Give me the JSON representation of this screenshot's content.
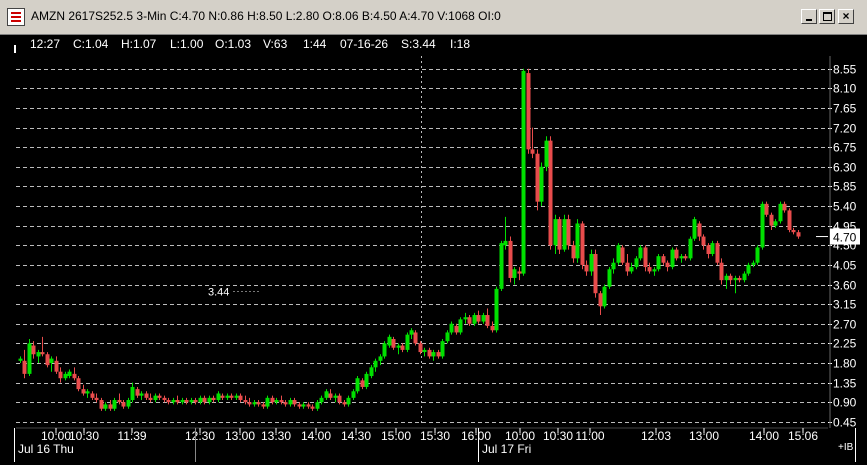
{
  "window": {
    "title": "AMZN 2617S252.5 3-Min C:4.70 N:0.86 H:8.50 L:2.80 O:8.06 B:4.50 A:4.70 V:1068 OI:0"
  },
  "infobar": {
    "time": "12:27",
    "close": "C:1.04",
    "high": "H:1.07",
    "low": "L:1.00",
    "open": "O:1.03",
    "volume": "V:63",
    "duration": "1:44",
    "date": "07-16-26",
    "strike": "S:3.44",
    "interval": "I:18"
  },
  "corner_label": "+IB",
  "chart_data": {
    "type": "candlestick",
    "title": "AMZN 2617S252.5 3-Min",
    "y_ticks": [
      "8.55",
      "8.10",
      "7.65",
      "7.20",
      "6.75",
      "6.30",
      "5.85",
      "5.40",
      "4.95",
      "4.50",
      "4.05",
      "3.60",
      "3.15",
      "2.70",
      "2.25",
      "1.80",
      "1.35",
      "0.90",
      "0.45"
    ],
    "ylim": [
      0.4,
      8.75
    ],
    "last_price": "4.70",
    "annotation": {
      "text": "3.44",
      "x": 12,
      "y": 3.44
    },
    "x_time_labels": [
      "10:00",
      "10:30",
      "11:39",
      "12:30",
      "13:00",
      "13:30",
      "14:00",
      "14:30",
      "15:00",
      "15:30",
      "16:00",
      "10:00",
      "10:30",
      "11:00",
      "12:03",
      "13:00",
      "14:00",
      "15:06"
    ],
    "x_time_index": [
      10,
      23,
      32,
      45,
      54,
      63,
      73,
      83,
      93,
      103,
      114,
      125,
      135,
      144,
      158,
      170,
      183,
      192
    ],
    "x_date_labels": [
      "Jul 16 Thu",
      "Jul 17 Fri"
    ],
    "x_date_index": [
      0,
      116
    ],
    "session_break_index": 116,
    "x_count": 203,
    "candles": [
      {
        "o": 1.85,
        "h": 1.95,
        "l": 1.8,
        "c": 1.9
      },
      {
        "o": 1.85,
        "h": 2.1,
        "l": 1.45,
        "c": 1.55
      },
      {
        "o": 1.55,
        "h": 2.35,
        "l": 1.5,
        "c": 2.25
      },
      {
        "o": 2.2,
        "h": 2.3,
        "l": 1.9,
        "c": 2.0
      },
      {
        "o": 1.95,
        "h": 2.1,
        "l": 1.8,
        "c": 2.05
      },
      {
        "o": 2.05,
        "h": 2.4,
        "l": 1.95,
        "c": 2.0
      },
      {
        "o": 2.0,
        "h": 2.05,
        "l": 1.7,
        "c": 1.75
      },
      {
        "o": 1.8,
        "h": 1.95,
        "l": 1.6,
        "c": 1.9
      },
      {
        "o": 1.85,
        "h": 1.95,
        "l": 1.55,
        "c": 1.6
      },
      {
        "o": 1.6,
        "h": 1.7,
        "l": 1.35,
        "c": 1.45
      },
      {
        "o": 1.45,
        "h": 1.6,
        "l": 1.4,
        "c": 1.55
      },
      {
        "o": 1.5,
        "h": 1.65,
        "l": 1.45,
        "c": 1.6
      },
      {
        "o": 1.55,
        "h": 1.7,
        "l": 1.4,
        "c": 1.45
      },
      {
        "o": 1.45,
        "h": 1.5,
        "l": 1.15,
        "c": 1.2
      },
      {
        "o": 1.2,
        "h": 1.3,
        "l": 1.05,
        "c": 1.1
      },
      {
        "o": 1.1,
        "h": 1.2,
        "l": 1.0,
        "c": 1.15
      },
      {
        "o": 1.1,
        "h": 1.15,
        "l": 0.95,
        "c": 1.0
      },
      {
        "o": 1.0,
        "h": 1.1,
        "l": 0.9,
        "c": 0.95
      },
      {
        "o": 0.95,
        "h": 1.0,
        "l": 0.7,
        "c": 0.75
      },
      {
        "o": 0.75,
        "h": 0.9,
        "l": 0.7,
        "c": 0.85
      },
      {
        "o": 0.85,
        "h": 0.95,
        "l": 0.7,
        "c": 0.75
      },
      {
        "o": 0.75,
        "h": 1.0,
        "l": 0.7,
        "c": 0.95
      },
      {
        "o": 0.95,
        "h": 1.1,
        "l": 0.85,
        "c": 0.9
      },
      {
        "o": 0.9,
        "h": 0.95,
        "l": 0.75,
        "c": 0.8
      },
      {
        "o": 0.8,
        "h": 1.0,
        "l": 0.75,
        "c": 0.95
      },
      {
        "o": 0.95,
        "h": 1.35,
        "l": 0.9,
        "c": 1.25
      },
      {
        "o": 1.2,
        "h": 1.25,
        "l": 1.0,
        "c": 1.05
      },
      {
        "o": 1.05,
        "h": 1.15,
        "l": 0.95,
        "c": 1.1
      },
      {
        "o": 1.1,
        "h": 1.15,
        "l": 0.95,
        "c": 1.0
      },
      {
        "o": 1.0,
        "h": 1.1,
        "l": 0.9,
        "c": 0.95
      },
      {
        "o": 0.95,
        "h": 1.1,
        "l": 0.9,
        "c": 1.05
      },
      {
        "o": 1.05,
        "h": 1.1,
        "l": 0.95,
        "c": 1.0
      },
      {
        "o": 1.0,
        "h": 1.05,
        "l": 0.9,
        "c": 0.95
      },
      {
        "o": 0.95,
        "h": 1.0,
        "l": 0.85,
        "c": 0.9
      },
      {
        "o": 0.9,
        "h": 1.0,
        "l": 0.85,
        "c": 0.95
      },
      {
        "o": 0.95,
        "h": 1.05,
        "l": 0.85,
        "c": 0.9
      },
      {
        "o": 0.9,
        "h": 1.0,
        "l": 0.85,
        "c": 0.95
      },
      {
        "o": 0.95,
        "h": 1.0,
        "l": 0.85,
        "c": 0.9
      },
      {
        "o": 0.9,
        "h": 1.0,
        "l": 0.85,
        "c": 0.95
      },
      {
        "o": 0.95,
        "h": 1.0,
        "l": 0.85,
        "c": 0.9
      },
      {
        "o": 0.9,
        "h": 1.05,
        "l": 0.85,
        "c": 1.0
      },
      {
        "o": 1.0,
        "h": 1.05,
        "l": 0.85,
        "c": 0.9
      },
      {
        "o": 0.9,
        "h": 1.05,
        "l": 0.85,
        "c": 1.0
      },
      {
        "o": 1.0,
        "h": 1.05,
        "l": 0.9,
        "c": 0.95
      },
      {
        "o": 0.95,
        "h": 1.15,
        "l": 0.9,
        "c": 1.1
      },
      {
        "o": 1.05,
        "h": 1.1,
        "l": 0.95,
        "c": 1.0
      },
      {
        "o": 1.0,
        "h": 1.1,
        "l": 0.95,
        "c": 1.05
      },
      {
        "o": 1.05,
        "h": 1.1,
        "l": 0.95,
        "c": 1.0
      },
      {
        "o": 1.0,
        "h": 1.1,
        "l": 0.95,
        "c": 1.05
      },
      {
        "o": 1.05,
        "h": 1.1,
        "l": 0.9,
        "c": 0.95
      },
      {
        "o": 0.95,
        "h": 1.05,
        "l": 0.85,
        "c": 0.9
      },
      {
        "o": 0.9,
        "h": 1.0,
        "l": 0.8,
        "c": 0.85
      },
      {
        "o": 0.85,
        "h": 0.95,
        "l": 0.8,
        "c": 0.9
      },
      {
        "o": 0.9,
        "h": 0.95,
        "l": 0.8,
        "c": 0.85
      },
      {
        "o": 0.85,
        "h": 0.9,
        "l": 0.75,
        "c": 0.8
      },
      {
        "o": 0.8,
        "h": 1.05,
        "l": 0.75,
        "c": 1.0
      },
      {
        "o": 1.0,
        "h": 1.05,
        "l": 0.85,
        "c": 0.9
      },
      {
        "o": 0.9,
        "h": 1.0,
        "l": 0.85,
        "c": 0.95
      },
      {
        "o": 0.95,
        "h": 1.05,
        "l": 0.85,
        "c": 0.9
      },
      {
        "o": 0.9,
        "h": 0.95,
        "l": 0.8,
        "c": 0.85
      },
      {
        "o": 0.85,
        "h": 1.0,
        "l": 0.8,
        "c": 0.95
      },
      {
        "o": 0.95,
        "h": 1.0,
        "l": 0.8,
        "c": 0.85
      },
      {
        "o": 0.85,
        "h": 0.9,
        "l": 0.75,
        "c": 0.8
      },
      {
        "o": 0.8,
        "h": 0.9,
        "l": 0.75,
        "c": 0.85
      },
      {
        "o": 0.85,
        "h": 0.9,
        "l": 0.75,
        "c": 0.8
      },
      {
        "o": 0.8,
        "h": 0.85,
        "l": 0.7,
        "c": 0.75
      },
      {
        "o": 0.75,
        "h": 0.95,
        "l": 0.7,
        "c": 0.9
      },
      {
        "o": 0.9,
        "h": 1.05,
        "l": 0.85,
        "c": 1.0
      },
      {
        "o": 1.0,
        "h": 1.2,
        "l": 0.95,
        "c": 1.15
      },
      {
        "o": 1.1,
        "h": 1.2,
        "l": 0.95,
        "c": 1.0
      },
      {
        "o": 1.0,
        "h": 1.1,
        "l": 0.9,
        "c": 1.05
      },
      {
        "o": 1.05,
        "h": 1.1,
        "l": 0.85,
        "c": 0.9
      },
      {
        "o": 0.9,
        "h": 0.95,
        "l": 0.8,
        "c": 0.85
      },
      {
        "o": 0.85,
        "h": 1.05,
        "l": 0.8,
        "c": 1.0
      },
      {
        "o": 1.0,
        "h": 1.2,
        "l": 0.95,
        "c": 1.15
      },
      {
        "o": 1.15,
        "h": 1.5,
        "l": 1.1,
        "c": 1.45
      },
      {
        "o": 1.4,
        "h": 1.45,
        "l": 1.2,
        "c": 1.25
      },
      {
        "o": 1.25,
        "h": 1.6,
        "l": 1.2,
        "c": 1.55
      },
      {
        "o": 1.5,
        "h": 1.75,
        "l": 1.45,
        "c": 1.7
      },
      {
        "o": 1.7,
        "h": 1.9,
        "l": 1.6,
        "c": 1.85
      },
      {
        "o": 1.85,
        "h": 2.0,
        "l": 1.75,
        "c": 1.95
      },
      {
        "o": 1.95,
        "h": 2.3,
        "l": 1.9,
        "c": 2.25
      },
      {
        "o": 2.2,
        "h": 2.45,
        "l": 2.15,
        "c": 2.4
      },
      {
        "o": 2.35,
        "h": 2.4,
        "l": 2.1,
        "c": 2.15
      },
      {
        "o": 2.15,
        "h": 2.25,
        "l": 2.0,
        "c": 2.2
      },
      {
        "o": 2.2,
        "h": 2.25,
        "l": 2.05,
        "c": 2.1
      },
      {
        "o": 2.1,
        "h": 2.5,
        "l": 2.05,
        "c": 2.45
      },
      {
        "o": 2.45,
        "h": 2.6,
        "l": 2.35,
        "c": 2.55
      },
      {
        "o": 2.5,
        "h": 2.55,
        "l": 2.2,
        "c": 2.25
      },
      {
        "o": 2.25,
        "h": 2.3,
        "l": 2.0,
        "c": 2.05
      },
      {
        "o": 2.05,
        "h": 2.15,
        "l": 1.95,
        "c": 2.1
      },
      {
        "o": 2.1,
        "h": 2.15,
        "l": 1.9,
        "c": 1.95
      },
      {
        "o": 1.95,
        "h": 2.1,
        "l": 1.85,
        "c": 2.05
      },
      {
        "o": 2.05,
        "h": 2.1,
        "l": 1.9,
        "c": 1.95
      },
      {
        "o": 1.95,
        "h": 2.35,
        "l": 1.9,
        "c": 2.3
      },
      {
        "o": 2.3,
        "h": 2.55,
        "l": 2.25,
        "c": 2.5
      },
      {
        "o": 2.5,
        "h": 2.75,
        "l": 2.45,
        "c": 2.7
      },
      {
        "o": 2.65,
        "h": 2.7,
        "l": 2.45,
        "c": 2.5
      },
      {
        "o": 2.5,
        "h": 2.85,
        "l": 2.45,
        "c": 2.8
      },
      {
        "o": 2.8,
        "h": 2.95,
        "l": 2.7,
        "c": 2.85
      },
      {
        "o": 2.85,
        "h": 2.9,
        "l": 2.65,
        "c": 2.7
      },
      {
        "o": 2.7,
        "h": 2.95,
        "l": 2.65,
        "c": 2.9
      },
      {
        "o": 2.9,
        "h": 3.0,
        "l": 2.7,
        "c": 2.75
      },
      {
        "o": 2.75,
        "h": 2.95,
        "l": 2.7,
        "c": 2.9
      },
      {
        "o": 2.9,
        "h": 3.05,
        "l": 2.6,
        "c": 2.65
      },
      {
        "o": 2.65,
        "h": 2.75,
        "l": 2.5,
        "c": 2.55
      },
      {
        "o": 2.55,
        "h": 3.55,
        "l": 2.5,
        "c": 3.5
      },
      {
        "o": 3.5,
        "h": 4.6,
        "l": 3.45,
        "c": 4.55
      },
      {
        "o": 4.5,
        "h": 5.15,
        "l": 4.4,
        "c": 4.6
      },
      {
        "o": 4.6,
        "h": 4.7,
        "l": 3.65,
        "c": 3.75
      },
      {
        "o": 3.75,
        "h": 4.0,
        "l": 3.6,
        "c": 3.95
      },
      {
        "o": 3.9,
        "h": 4.0,
        "l": 3.7,
        "c": 3.85
      },
      {
        "o": 3.85,
        "h": 8.55,
        "l": 3.8,
        "c": 8.5
      },
      {
        "o": 8.45,
        "h": 8.55,
        "l": 6.6,
        "c": 6.7
      },
      {
        "o": 6.7,
        "h": 7.2,
        "l": 6.5,
        "c": 6.6
      },
      {
        "o": 6.6,
        "h": 6.7,
        "l": 5.3,
        "c": 5.5
      },
      {
        "o": 5.5,
        "h": 6.4,
        "l": 5.4,
        "c": 6.3
      },
      {
        "o": 6.3,
        "h": 7.0,
        "l": 6.2,
        "c": 6.9
      },
      {
        "o": 6.9,
        "h": 7.0,
        "l": 4.4,
        "c": 4.5
      },
      {
        "o": 4.5,
        "h": 5.2,
        "l": 4.3,
        "c": 5.1
      },
      {
        "o": 5.1,
        "h": 5.15,
        "l": 4.3,
        "c": 4.4
      },
      {
        "o": 4.4,
        "h": 5.2,
        "l": 4.35,
        "c": 5.1
      },
      {
        "o": 5.1,
        "h": 5.2,
        "l": 4.4,
        "c": 4.5
      },
      {
        "o": 4.5,
        "h": 4.6,
        "l": 4.1,
        "c": 4.2
      },
      {
        "o": 4.2,
        "h": 5.1,
        "l": 4.1,
        "c": 5.0
      },
      {
        "o": 5.0,
        "h": 5.05,
        "l": 3.95,
        "c": 4.05
      },
      {
        "o": 4.05,
        "h": 4.15,
        "l": 3.8,
        "c": 3.9
      },
      {
        "o": 3.9,
        "h": 4.4,
        "l": 3.8,
        "c": 4.3
      },
      {
        "o": 4.3,
        "h": 4.4,
        "l": 3.3,
        "c": 3.4
      },
      {
        "o": 3.4,
        "h": 3.45,
        "l": 2.9,
        "c": 3.1
      },
      {
        "o": 3.1,
        "h": 3.6,
        "l": 3.05,
        "c": 3.55
      },
      {
        "o": 3.55,
        "h": 4.0,
        "l": 3.5,
        "c": 3.95
      },
      {
        "o": 3.95,
        "h": 4.2,
        "l": 3.85,
        "c": 4.1
      },
      {
        "o": 4.1,
        "h": 4.55,
        "l": 4.05,
        "c": 4.5
      },
      {
        "o": 4.45,
        "h": 4.5,
        "l": 4.05,
        "c": 4.1
      },
      {
        "o": 4.1,
        "h": 4.3,
        "l": 3.8,
        "c": 3.9
      },
      {
        "o": 3.9,
        "h": 4.1,
        "l": 3.85,
        "c": 4.0
      },
      {
        "o": 4.0,
        "h": 4.25,
        "l": 3.95,
        "c": 4.2
      },
      {
        "o": 4.2,
        "h": 4.5,
        "l": 4.15,
        "c": 4.45
      },
      {
        "o": 4.45,
        "h": 4.5,
        "l": 3.9,
        "c": 4.0
      },
      {
        "o": 4.0,
        "h": 4.1,
        "l": 3.85,
        "c": 3.9
      },
      {
        "o": 3.9,
        "h": 4.0,
        "l": 3.8,
        "c": 3.95
      },
      {
        "o": 3.95,
        "h": 4.3,
        "l": 3.9,
        "c": 4.25
      },
      {
        "o": 4.25,
        "h": 4.3,
        "l": 4.05,
        "c": 4.1
      },
      {
        "o": 4.1,
        "h": 4.15,
        "l": 3.9,
        "c": 4.0
      },
      {
        "o": 4.0,
        "h": 4.45,
        "l": 3.95,
        "c": 4.4
      },
      {
        "o": 4.4,
        "h": 4.45,
        "l": 4.15,
        "c": 4.2
      },
      {
        "o": 4.2,
        "h": 4.3,
        "l": 4.1,
        "c": 4.25
      },
      {
        "o": 4.25,
        "h": 4.3,
        "l": 4.15,
        "c": 4.2
      },
      {
        "o": 4.2,
        "h": 4.7,
        "l": 4.15,
        "c": 4.65
      },
      {
        "o": 4.65,
        "h": 5.15,
        "l": 4.6,
        "c": 5.1
      },
      {
        "o": 5.0,
        "h": 5.05,
        "l": 4.6,
        "c": 4.7
      },
      {
        "o": 4.7,
        "h": 4.75,
        "l": 4.4,
        "c": 4.5
      },
      {
        "o": 4.5,
        "h": 4.55,
        "l": 4.2,
        "c": 4.3
      },
      {
        "o": 4.3,
        "h": 4.6,
        "l": 4.25,
        "c": 4.55
      },
      {
        "o": 4.55,
        "h": 4.6,
        "l": 4.05,
        "c": 4.1
      },
      {
        "o": 4.1,
        "h": 4.2,
        "l": 3.6,
        "c": 3.7
      },
      {
        "o": 3.7,
        "h": 3.85,
        "l": 3.5,
        "c": 3.8
      },
      {
        "o": 3.8,
        "h": 3.85,
        "l": 3.6,
        "c": 3.7
      },
      {
        "o": 3.7,
        "h": 3.8,
        "l": 3.4,
        "c": 3.75
      },
      {
        "o": 3.75,
        "h": 3.8,
        "l": 3.65,
        "c": 3.7
      },
      {
        "o": 3.7,
        "h": 3.9,
        "l": 3.65,
        "c": 3.85
      },
      {
        "o": 3.85,
        "h": 4.1,
        "l": 3.8,
        "c": 4.05
      },
      {
        "o": 4.05,
        "h": 4.15,
        "l": 4.0,
        "c": 4.1
      },
      {
        "o": 4.1,
        "h": 4.5,
        "l": 4.05,
        "c": 4.45
      },
      {
        "o": 4.45,
        "h": 5.5,
        "l": 4.4,
        "c": 5.45
      },
      {
        "o": 5.45,
        "h": 5.5,
        "l": 5.15,
        "c": 5.2
      },
      {
        "o": 5.2,
        "h": 5.25,
        "l": 4.85,
        "c": 4.95
      },
      {
        "o": 4.95,
        "h": 5.1,
        "l": 4.9,
        "c": 5.05
      },
      {
        "o": 5.05,
        "h": 5.5,
        "l": 5.0,
        "c": 5.45
      },
      {
        "o": 5.45,
        "h": 5.5,
        "l": 5.25,
        "c": 5.3
      },
      {
        "o": 5.3,
        "h": 5.35,
        "l": 4.8,
        "c": 4.85
      },
      {
        "o": 4.85,
        "h": 4.9,
        "l": 4.75,
        "c": 4.8
      },
      {
        "o": 4.8,
        "h": 4.85,
        "l": 4.65,
        "c": 4.7
      }
    ],
    "candle_index": [
      0,
      2,
      4,
      6,
      7,
      9,
      12,
      13,
      15,
      17,
      18,
      20,
      22,
      24,
      26,
      28,
      29,
      31,
      33,
      35,
      37,
      38,
      40,
      42,
      44,
      46,
      48,
      49,
      51,
      53,
      55,
      56,
      58,
      60,
      62,
      64,
      65,
      67,
      69,
      71,
      73,
      74,
      76,
      78,
      80,
      82,
      83,
      85,
      87,
      89,
      91,
      92,
      94,
      96,
      98,
      100,
      101,
      103,
      105,
      107,
      109,
      110,
      112,
      114,
      116,
      118,
      120,
      121,
      123,
      125,
      127,
      129,
      130,
      132,
      134,
      136,
      138,
      139,
      141,
      143,
      145,
      147,
      148,
      150,
      152,
      154,
      156,
      157,
      159,
      161,
      163,
      165,
      166,
      168,
      170,
      172,
      174,
      175,
      177,
      179,
      181,
      183,
      184,
      186,
      188,
      190,
      192,
      193,
      195,
      197,
      199,
      200,
      201,
      202,
      203,
      204,
      205,
      206,
      207,
      208,
      209,
      210,
      211,
      212,
      213,
      214,
      215,
      216,
      217,
      218,
      219,
      220,
      221,
      222,
      223,
      224,
      225,
      226,
      227,
      228,
      229,
      230,
      231,
      232,
      233,
      234,
      235,
      236,
      237,
      238,
      239,
      240,
      241,
      242,
      243,
      244,
      245,
      246,
      247,
      248,
      249,
      250,
      251,
      252,
      253,
      254,
      255,
      256,
      257,
      258,
      259,
      260,
      261,
      262,
      263,
      264,
      265,
      266,
      267,
      268,
      269,
      270,
      271,
      272
    ]
  },
  "colors": {
    "up": "#00e000",
    "down": "#e84c4c",
    "grid": "#bcbcbc",
    "text": "#ffffff",
    "background": "#000000",
    "price_tag_bg": "#ffffff",
    "price_tag_text": "#000000"
  }
}
